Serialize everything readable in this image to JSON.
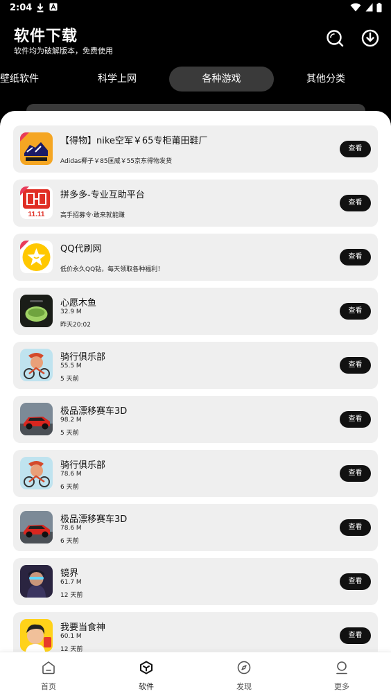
{
  "status_bar": {
    "time": "2:04"
  },
  "header": {
    "title": "软件下载",
    "subtitle": "软件均为破解版本，免费使用"
  },
  "tabs": [
    {
      "label": "壁纸软件"
    },
    {
      "label": "科学上网"
    },
    {
      "label": "各种游戏",
      "active": true
    },
    {
      "label": "其他分类"
    }
  ],
  "items": [
    {
      "name": "【得物】nike空军￥65专柜莆田鞋厂",
      "desc": "Adidas椰子￥85匡威￥55京东得物发货",
      "view": "查看",
      "icon": "dewu-shoe-icon"
    },
    {
      "name": "拼多多-专业互助平台",
      "desc": "高手招募令·敢来就能赚",
      "view": "查看",
      "icon": "pinduoduo-icon"
    },
    {
      "name": "QQ代刷网",
      "desc": "低价永久QQ钻，每天领取各种福利！",
      "view": "查看",
      "icon": "qq-star-icon"
    },
    {
      "name": "心愿木鱼",
      "size": "32.9 M",
      "time": "昨天20:02",
      "view": "查看",
      "icon": "wooden-fish-icon"
    },
    {
      "name": "骑行俱乐部",
      "size": "55.5 M",
      "time": "5 天前",
      "view": "查看",
      "icon": "cycling-club-icon"
    },
    {
      "name": "极品漂移赛车3D",
      "size": "98.2 M",
      "time": "5 天前",
      "view": "查看",
      "icon": "drift-car-icon"
    },
    {
      "name": "骑行俱乐部",
      "size": "78.6 M",
      "time": "6 天前",
      "view": "查看",
      "icon": "cycling-club-icon"
    },
    {
      "name": "极品漂移赛车3D",
      "size": "78.6 M",
      "time": "6 天前",
      "view": "查看",
      "icon": "drift-car-icon"
    },
    {
      "name": "镜界",
      "size": "61.7 M",
      "time": "12 天前",
      "view": "查看",
      "icon": "mirror-world-icon"
    },
    {
      "name": "我要当食神",
      "size": "60.1 M",
      "time": "12 天前",
      "view": "查看",
      "icon": "food-god-icon"
    }
  ],
  "nav": [
    {
      "label": "首页",
      "icon": "home-icon"
    },
    {
      "label": "软件",
      "icon": "cube-icon",
      "active": true
    },
    {
      "label": "发现",
      "icon": "compass-icon"
    },
    {
      "label": "更多",
      "icon": "user-icon"
    }
  ]
}
